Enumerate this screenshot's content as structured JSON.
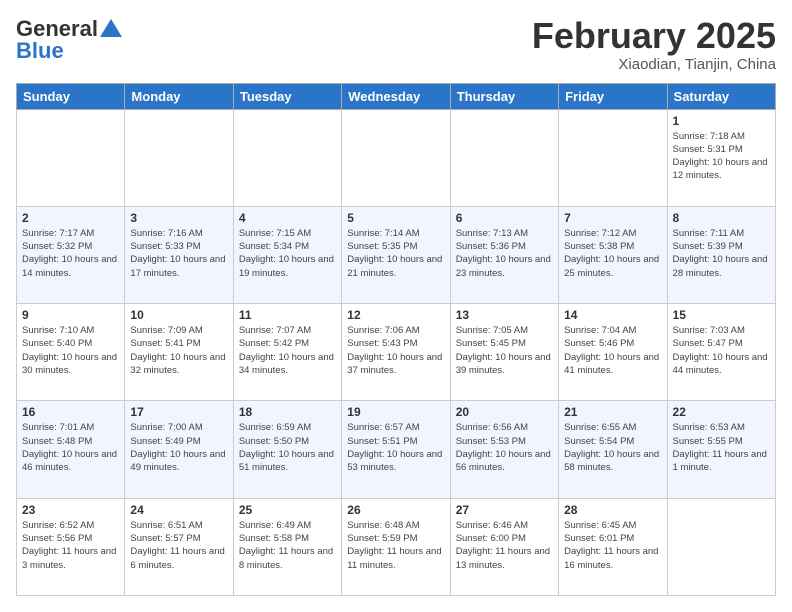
{
  "header": {
    "logo_line1": "General",
    "logo_line2": "Blue",
    "month": "February 2025",
    "location": "Xiaodian, Tianjin, China"
  },
  "weekdays": [
    "Sunday",
    "Monday",
    "Tuesday",
    "Wednesday",
    "Thursday",
    "Friday",
    "Saturday"
  ],
  "weeks": [
    [
      {
        "day": "",
        "info": ""
      },
      {
        "day": "",
        "info": ""
      },
      {
        "day": "",
        "info": ""
      },
      {
        "day": "",
        "info": ""
      },
      {
        "day": "",
        "info": ""
      },
      {
        "day": "",
        "info": ""
      },
      {
        "day": "1",
        "info": "Sunrise: 7:18 AM\nSunset: 5:31 PM\nDaylight: 10 hours\nand 12 minutes."
      }
    ],
    [
      {
        "day": "2",
        "info": "Sunrise: 7:17 AM\nSunset: 5:32 PM\nDaylight: 10 hours\nand 14 minutes."
      },
      {
        "day": "3",
        "info": "Sunrise: 7:16 AM\nSunset: 5:33 PM\nDaylight: 10 hours\nand 17 minutes."
      },
      {
        "day": "4",
        "info": "Sunrise: 7:15 AM\nSunset: 5:34 PM\nDaylight: 10 hours\nand 19 minutes."
      },
      {
        "day": "5",
        "info": "Sunrise: 7:14 AM\nSunset: 5:35 PM\nDaylight: 10 hours\nand 21 minutes."
      },
      {
        "day": "6",
        "info": "Sunrise: 7:13 AM\nSunset: 5:36 PM\nDaylight: 10 hours\nand 23 minutes."
      },
      {
        "day": "7",
        "info": "Sunrise: 7:12 AM\nSunset: 5:38 PM\nDaylight: 10 hours\nand 25 minutes."
      },
      {
        "day": "8",
        "info": "Sunrise: 7:11 AM\nSunset: 5:39 PM\nDaylight: 10 hours\nand 28 minutes."
      }
    ],
    [
      {
        "day": "9",
        "info": "Sunrise: 7:10 AM\nSunset: 5:40 PM\nDaylight: 10 hours\nand 30 minutes."
      },
      {
        "day": "10",
        "info": "Sunrise: 7:09 AM\nSunset: 5:41 PM\nDaylight: 10 hours\nand 32 minutes."
      },
      {
        "day": "11",
        "info": "Sunrise: 7:07 AM\nSunset: 5:42 PM\nDaylight: 10 hours\nand 34 minutes."
      },
      {
        "day": "12",
        "info": "Sunrise: 7:06 AM\nSunset: 5:43 PM\nDaylight: 10 hours\nand 37 minutes."
      },
      {
        "day": "13",
        "info": "Sunrise: 7:05 AM\nSunset: 5:45 PM\nDaylight: 10 hours\nand 39 minutes."
      },
      {
        "day": "14",
        "info": "Sunrise: 7:04 AM\nSunset: 5:46 PM\nDaylight: 10 hours\nand 41 minutes."
      },
      {
        "day": "15",
        "info": "Sunrise: 7:03 AM\nSunset: 5:47 PM\nDaylight: 10 hours\nand 44 minutes."
      }
    ],
    [
      {
        "day": "16",
        "info": "Sunrise: 7:01 AM\nSunset: 5:48 PM\nDaylight: 10 hours\nand 46 minutes."
      },
      {
        "day": "17",
        "info": "Sunrise: 7:00 AM\nSunset: 5:49 PM\nDaylight: 10 hours\nand 49 minutes."
      },
      {
        "day": "18",
        "info": "Sunrise: 6:59 AM\nSunset: 5:50 PM\nDaylight: 10 hours\nand 51 minutes."
      },
      {
        "day": "19",
        "info": "Sunrise: 6:57 AM\nSunset: 5:51 PM\nDaylight: 10 hours\nand 53 minutes."
      },
      {
        "day": "20",
        "info": "Sunrise: 6:56 AM\nSunset: 5:53 PM\nDaylight: 10 hours\nand 56 minutes."
      },
      {
        "day": "21",
        "info": "Sunrise: 6:55 AM\nSunset: 5:54 PM\nDaylight: 10 hours\nand 58 minutes."
      },
      {
        "day": "22",
        "info": "Sunrise: 6:53 AM\nSunset: 5:55 PM\nDaylight: 11 hours\nand 1 minute."
      }
    ],
    [
      {
        "day": "23",
        "info": "Sunrise: 6:52 AM\nSunset: 5:56 PM\nDaylight: 11 hours\nand 3 minutes."
      },
      {
        "day": "24",
        "info": "Sunrise: 6:51 AM\nSunset: 5:57 PM\nDaylight: 11 hours\nand 6 minutes."
      },
      {
        "day": "25",
        "info": "Sunrise: 6:49 AM\nSunset: 5:58 PM\nDaylight: 11 hours\nand 8 minutes."
      },
      {
        "day": "26",
        "info": "Sunrise: 6:48 AM\nSunset: 5:59 PM\nDaylight: 11 hours\nand 11 minutes."
      },
      {
        "day": "27",
        "info": "Sunrise: 6:46 AM\nSunset: 6:00 PM\nDaylight: 11 hours\nand 13 minutes."
      },
      {
        "day": "28",
        "info": "Sunrise: 6:45 AM\nSunset: 6:01 PM\nDaylight: 11 hours\nand 16 minutes."
      },
      {
        "day": "",
        "info": ""
      }
    ]
  ]
}
